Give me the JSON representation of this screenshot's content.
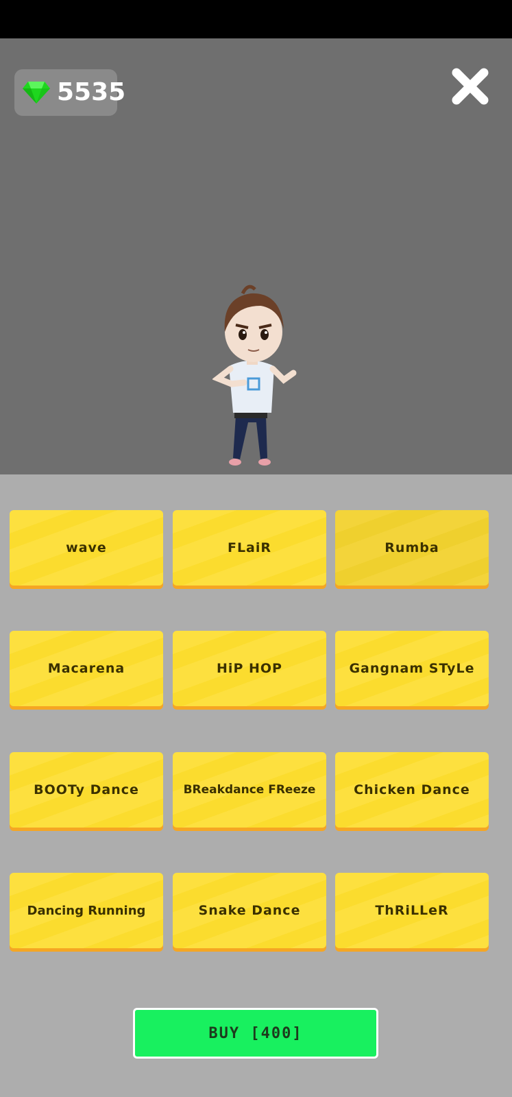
{
  "header": {
    "gem_count": "5535",
    "gem_icon": "gem-icon",
    "close_icon": "close-icon"
  },
  "colors": {
    "stage_bg": "#6f6f6f",
    "panel_bg": "#adadad",
    "button_yellow": "#fde03f",
    "button_shadow": "#f5a623",
    "buy_green": "#18f05f",
    "gem_green": "#22dd22"
  },
  "dances": [
    {
      "label": "wave",
      "selected": false
    },
    {
      "label": "FLaiR",
      "selected": false
    },
    {
      "label": "Rumba",
      "selected": true
    },
    {
      "label": "Macarena",
      "selected": false
    },
    {
      "label": "HiP HOP",
      "selected": false
    },
    {
      "label": "Gangnam STyLe",
      "selected": false
    },
    {
      "label": "BOOTy Dance",
      "selected": false
    },
    {
      "label": "BReakdance FReeze",
      "selected": false
    },
    {
      "label": "Chicken Dance",
      "selected": false
    },
    {
      "label": "Dancing Running",
      "selected": false
    },
    {
      "label": "Snake Dance",
      "selected": false
    },
    {
      "label": "ThRiLLeR",
      "selected": false
    }
  ],
  "buy": {
    "label": "BUY [400]"
  }
}
